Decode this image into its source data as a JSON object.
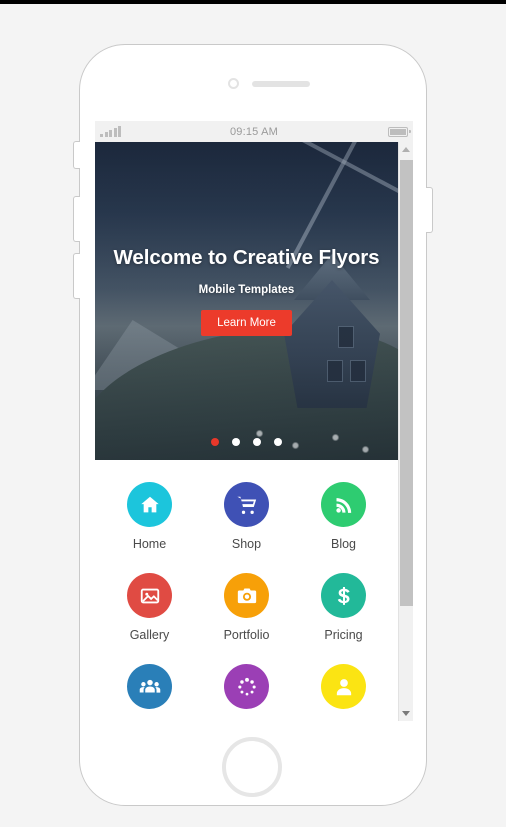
{
  "device": {
    "frame_label": "smartphone-mockup",
    "camera": "front-camera",
    "speaker": "earpiece-speaker",
    "home_button": "home-button"
  },
  "status_bar": {
    "signal_icon": "signal-bars-icon",
    "time": "09:15 AM",
    "battery_icon": "battery-full-icon"
  },
  "hero": {
    "title": "Welcome to Creative Flyors",
    "subtitle": "Mobile Templates",
    "button_label": "Learn More",
    "button_color": "#ec3b2b",
    "dots": [
      {
        "active": true,
        "color": "#e8382a"
      },
      {
        "active": false,
        "color": "#ffffff"
      },
      {
        "active": false,
        "color": "#ffffff"
      },
      {
        "active": false,
        "color": "#ffffff"
      }
    ]
  },
  "grid": {
    "tiles": [
      {
        "label": "Home",
        "icon": "home-icon",
        "color": "#1cc5dc"
      },
      {
        "label": "Shop",
        "icon": "cart-icon",
        "color": "#3f51b5"
      },
      {
        "label": "Blog",
        "icon": "rss-icon",
        "color": "#2ecc71"
      },
      {
        "label": "Gallery",
        "icon": "image-icon",
        "color": "#e04b43"
      },
      {
        "label": "Portfolio",
        "icon": "camera-icon",
        "color": "#f7a008"
      },
      {
        "label": "Pricing",
        "icon": "dollar-icon",
        "color": "#22b999"
      },
      {
        "label": "",
        "icon": "users-icon",
        "color": "#2a7fb8"
      },
      {
        "label": "",
        "icon": "dots-circle-icon",
        "color": "#9b3fb5"
      },
      {
        "label": "",
        "icon": "user-icon",
        "color": "#fbe413"
      }
    ]
  },
  "scrollbar": {
    "up_arrow": "scroll-up-arrow",
    "down_arrow": "scroll-down-arrow",
    "thumb": "scroll-thumb"
  }
}
